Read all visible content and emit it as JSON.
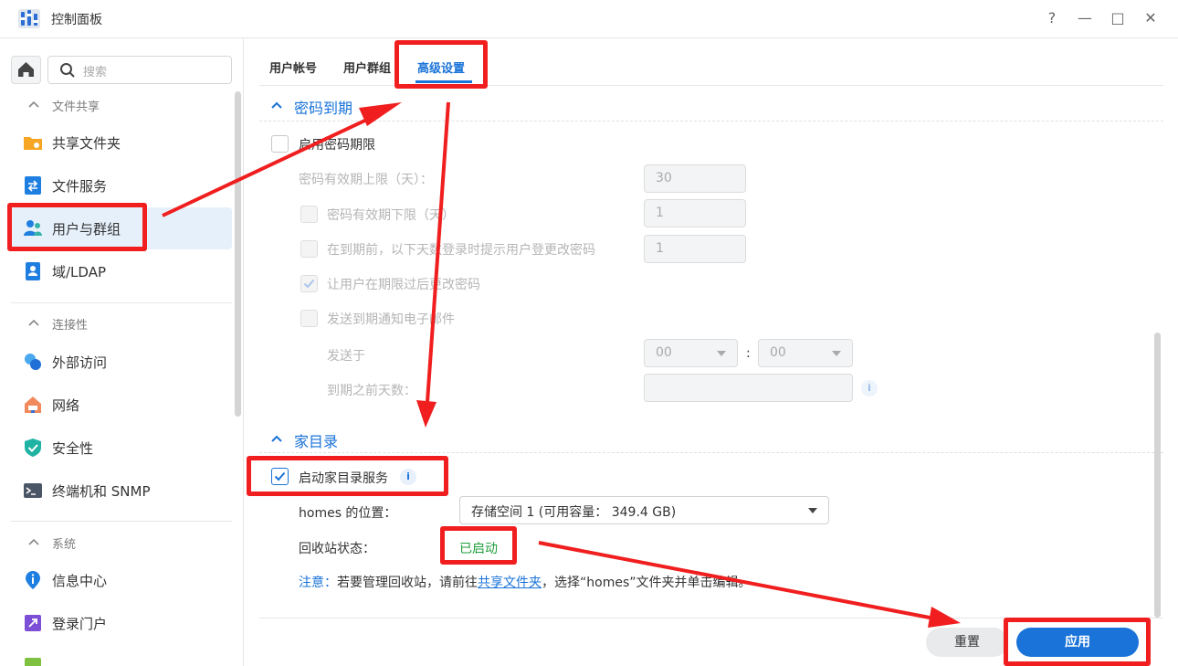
{
  "window": {
    "title": "控制面板",
    "controls": {
      "help": "?",
      "minimize": "—",
      "maximize": "□",
      "close": "✕"
    }
  },
  "sidebar": {
    "search_placeholder": "搜索",
    "sections": [
      {
        "label": "文件共享",
        "items": [
          "共享文件夹",
          "文件服务",
          "用户与群组",
          "域/LDAP"
        ]
      },
      {
        "label": "连接性",
        "items": [
          "外部访问",
          "网络",
          "安全性",
          "终端机和 SNMP"
        ]
      },
      {
        "label": "系统",
        "items": [
          "信息中心",
          "登录门户"
        ]
      }
    ],
    "active_item": "用户与群组"
  },
  "tabs": {
    "items": [
      "用户帐号",
      "用户群组",
      "高级设置"
    ],
    "active": "高级设置"
  },
  "password_expiry": {
    "title": "密码到期",
    "enable_label": "启用密码期限",
    "max_label": "密码有效期上限（天）：",
    "max_value": "30",
    "min_label": "密码有效期下限（天）",
    "min_value": "1",
    "prompt_label": "在到期前，以下天数登录时提示用户登更改密码",
    "prompt_value": "1",
    "allow_change_label": "让用户在期限过后更改密码",
    "notify_label": "发送到期通知电子邮件",
    "send_at_label": "发送于",
    "hour_value": "00",
    "time_sep": ":",
    "minute_value": "00",
    "days_before_label": "到期之前天数：",
    "days_before_value": ""
  },
  "home_dir": {
    "title": "家目录",
    "enable_label": "启动家目录服务",
    "location_label": "homes 的位置：",
    "location_value": "存储空间 1 (可用容量： 349.4 GB)",
    "recycle_label": "回收站状态：",
    "recycle_value": "已启动",
    "note_label": "注意：",
    "note_pre": "若要管理回收站，请前往",
    "note_link": "共享文件夹",
    "note_post": "，选择“homes”文件夹并单击编辑。"
  },
  "footer": {
    "reset": "重置",
    "apply": "应用"
  },
  "colors": {
    "accent": "#1a73d8",
    "annotation": "#f01e1e",
    "enabled_status": "#1e9e3a"
  },
  "icons": {
    "home": "home-icon",
    "search": "search-icon",
    "shared_folder": "folder-share-icon",
    "file_services": "file-services-icon",
    "users": "users-group-icon",
    "ldap": "id-card-icon",
    "external": "external-access-icon",
    "network": "network-house-icon",
    "security": "shield-check-icon",
    "terminal": "terminal-icon",
    "info": "info-center-icon",
    "portal": "login-portal-icon"
  }
}
